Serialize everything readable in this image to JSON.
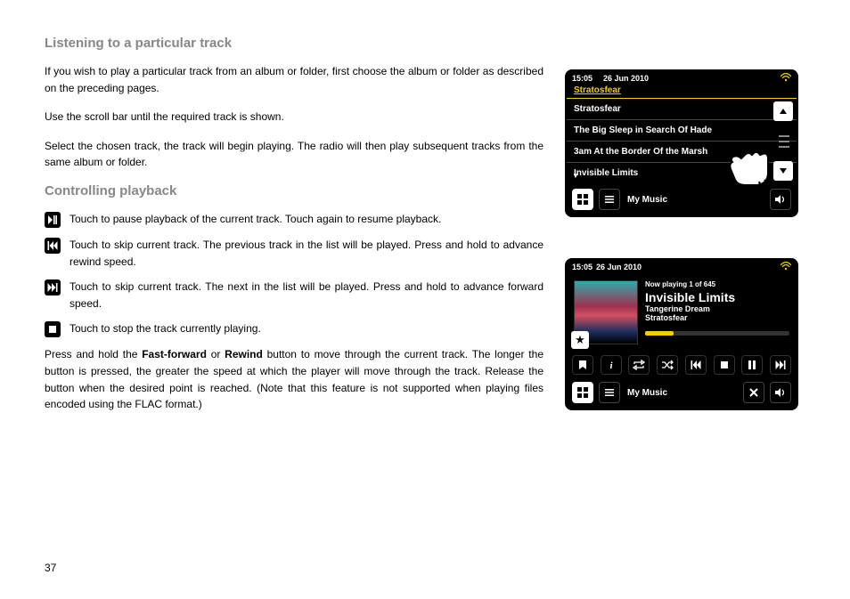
{
  "heading1": "Listening to a particular track",
  "para1": "If you wish to play a particular track from an album or folder, first choose the album or folder as described on the preceding pages.",
  "para2": "Use the scroll bar until the required track is shown.",
  "para3": "Select the chosen track, the track will begin playing. The radio will then play subsequent tracks from the same album or folder.",
  "heading2": "Controlling playback",
  "ctrl_pause": "Touch to pause playback of the current track. Touch again to resume playback.",
  "ctrl_prev": "Touch to skip current track. The previous track in the list will be played. Press and hold to advance rewind speed.",
  "ctrl_next": "Touch to skip current track. The next in the list will be played. Press and hold to advance forward speed.",
  "ctrl_stop": "Touch to stop the track currently playing.",
  "para_ff_pre": "Press and hold the ",
  "para_ff_b1": "Fast-forward",
  "para_ff_mid": " or ",
  "para_ff_b2": "Rewind",
  "para_ff_post": " button to move through the current track. The longer the button is pressed, the greater the speed at which the player will move through the track. Release the button when the desired point is reached. (Note that this feature is not supported when playing files encoded using the FLAC format.)",
  "page_number": "37",
  "screen1": {
    "time": "15:05",
    "date": "26 Jun 2010",
    "album": "Stratosfear",
    "tracks": [
      "Stratosfear",
      "The Big Sleep in Search Of Hade",
      "3am At the Border Of the Marsh",
      "Invisible Limits"
    ],
    "footer_label": "My Music"
  },
  "screen2": {
    "time": "15:05",
    "date": "26 Jun 2010",
    "counter": "Now playing 1 of 645",
    "title": "Invisible Limits",
    "artist": "Tangerine Dream",
    "album": "Stratosfear",
    "footer_label": "My Music"
  }
}
